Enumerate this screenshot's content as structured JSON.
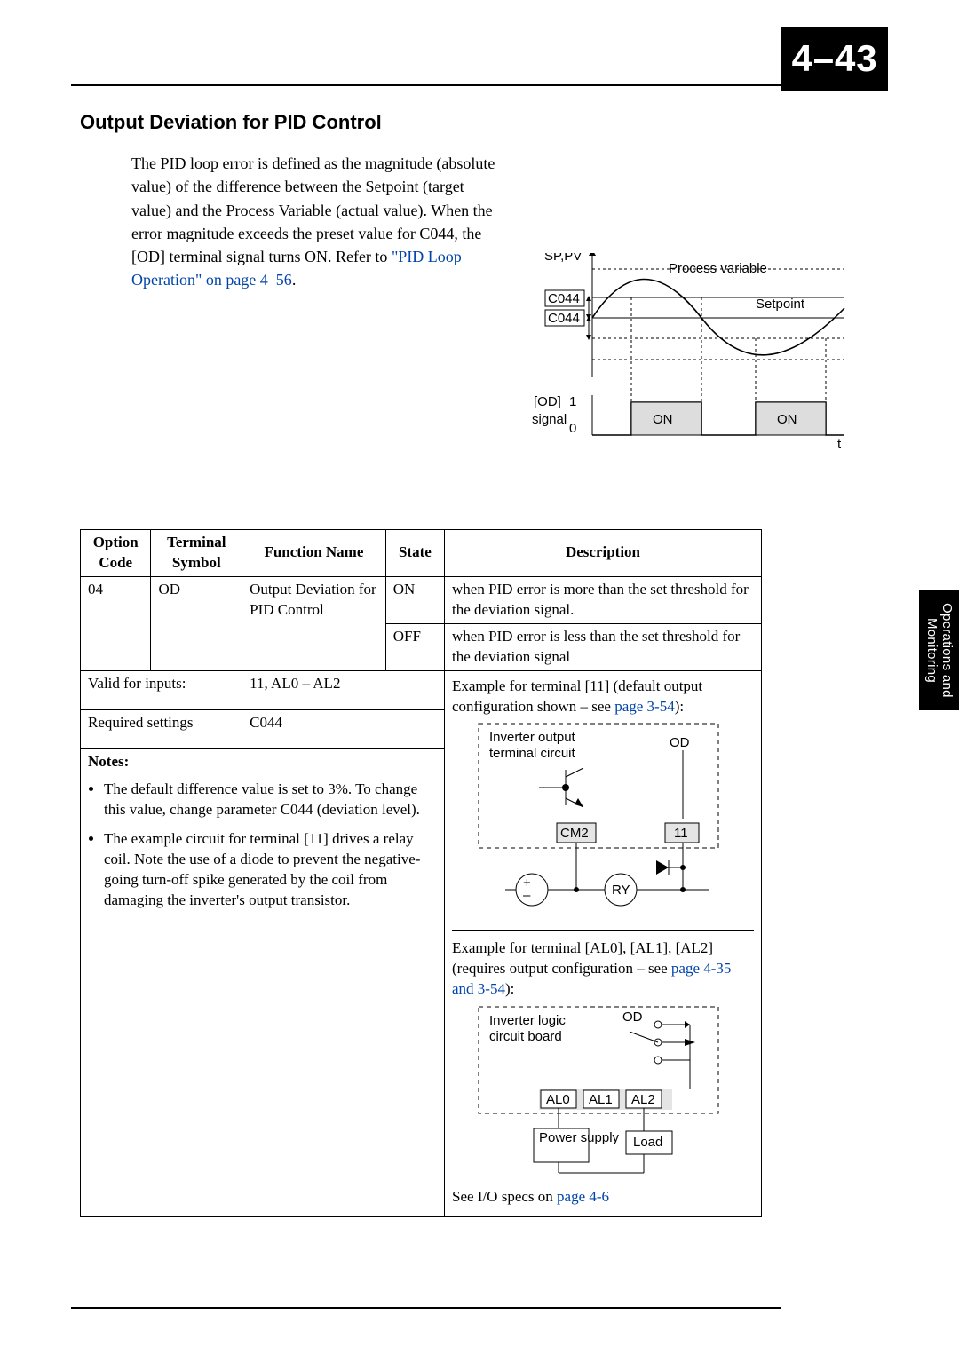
{
  "page": {
    "badge_left": "4–",
    "badge_right": "43",
    "side_tab": "Operations and\nMonitoring"
  },
  "section": {
    "title": "Output Deviation for PID Control",
    "body_a": "The PID loop error is defined as the magnitude (absolute value) of the difference between the Setpoint (target value) and the Process Variable (actual value). When the error magnitude exceeds the preset value for C044, the [OD] terminal signal turns ON. Refer to ",
    "body_link": "\"PID Loop Operation\" on page 4–56",
    "body_b": "."
  },
  "wave": {
    "sp_pv": "SP,PV",
    "proc_var": "Process variable",
    "setpoint": "Setpoint",
    "c044a": "C044",
    "c044b": "C044",
    "od": "[OD]",
    "signal": "signal",
    "one": "1",
    "zero": "0",
    "on1": "ON",
    "on2": "ON",
    "t": "t"
  },
  "table": {
    "head": {
      "opt": "Option Code",
      "term": "Terminal Symbol",
      "func": "Function Name",
      "state": "State",
      "desc": "Description"
    },
    "rows": {
      "code": "04",
      "sym": "OD",
      "func": "Output Deviation for PID Control",
      "state_on": "ON",
      "desc_on": "when PID error is more than the set threshold for the deviation signal.",
      "state_off": "OFF",
      "desc_off": "when PID error is less than the set threshold for the deviation signal"
    },
    "extra": {
      "valid_label": "Valid for inputs:",
      "valid_value": "11, AL0 – AL2",
      "req_label": "Required settings",
      "req_value": "C044"
    },
    "notes": {
      "heading": "Notes:",
      "n1": "The default difference value is set to 3%. To change this value, change parameter C044 (deviation level).",
      "n2": "The example circuit for terminal [11] drives a relay coil. Note the use of a diode to prevent the negative-going turn-off spike generated by the coil from damaging the inverter's output transistor."
    },
    "example1": {
      "intro_a": "Example for terminal [11] (default output configuration shown – see ",
      "intro_link": "page 3-54",
      "intro_b": "):",
      "box_a": "Inverter output",
      "box_b": "terminal circuit",
      "od": "OD",
      "cm2": "CM2",
      "t11": "11",
      "ry": "RY",
      "plus": "+",
      "minus": "–"
    },
    "example2": {
      "intro_a": "Example for terminal [AL0], [AL1], [AL2] (requires output configuration – see ",
      "intro_link": "page 4-35 and 3-54",
      "intro_b": "):",
      "box_a": "Inverter logic",
      "box_b": "circuit board",
      "od": "OD",
      "al0": "AL0",
      "al1": "AL1",
      "al2": "AL2",
      "power": "Power supply",
      "load": "Load"
    },
    "footer_a": "See I/O specs on ",
    "footer_link": "page 4-6"
  }
}
